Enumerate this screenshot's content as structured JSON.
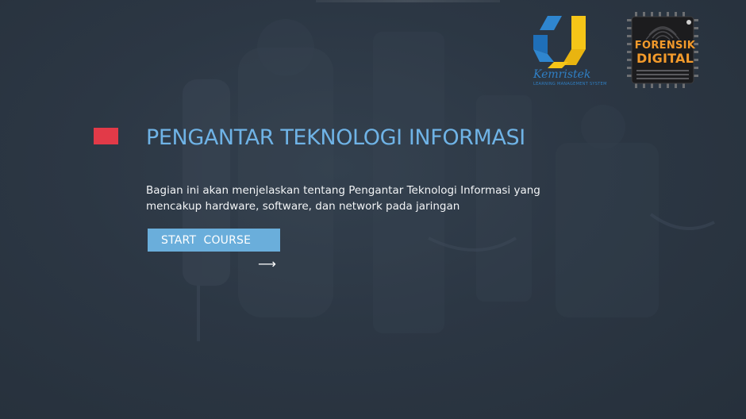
{
  "course": {
    "title": "PENGANTAR TEKNOLOGI INFORMASI",
    "description_lines": [
      "Bagian ini akan menjelaskan tentang Pengantar Teknologi Informasi yang",
      "mencakup hardware, software, dan network pada jaringan"
    ],
    "start_button_label": "START  COURSE",
    "arrow_glyph": "⟶"
  },
  "logos": {
    "kemristek": {
      "name": "Kemristek",
      "subtitle": "LEARNING MANAGEMENT SYSTEM",
      "icon": "kemristek-logo-icon"
    },
    "forensik_digital": {
      "line1": "FORENSIK",
      "line2": "DIGITAL",
      "icon": "fingerprint-chip-icon"
    }
  },
  "colors": {
    "background": "#2a3440",
    "title": "#6fb3e6",
    "accent_square": "#e23a48",
    "button": "#6aaedb",
    "text": "#f2f4f6",
    "logo_blue": "#2f7fc4",
    "logo_yellow": "#f5c518",
    "logo_orange": "#f39a2b"
  }
}
